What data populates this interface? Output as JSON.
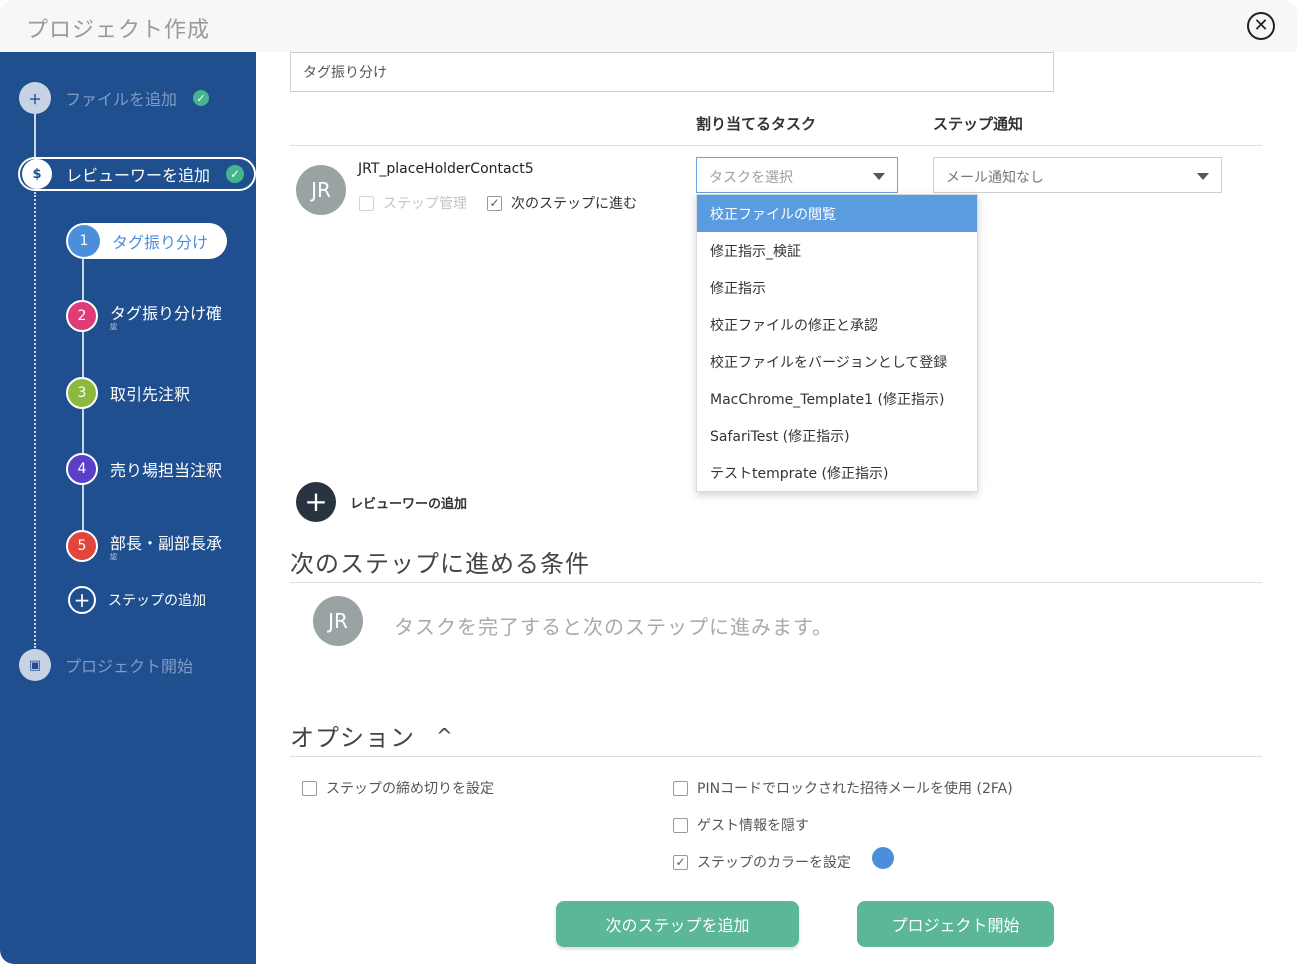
{
  "window": {
    "title": "プロジェクト作成"
  },
  "sidebar": {
    "steps": [
      {
        "label": "ファイルを追加"
      },
      {
        "label": "レビューワーを追加"
      },
      {
        "label": "プロジェクト開始"
      }
    ],
    "substeps": [
      {
        "num": "1",
        "label": "タグ振り分け"
      },
      {
        "num": "2",
        "label": "タグ振り分け確",
        "sub": "認"
      },
      {
        "num": "3",
        "label": "取引先注釈"
      },
      {
        "num": "4",
        "label": "売り場担当注釈"
      },
      {
        "num": "5",
        "label": "部長・副部長承",
        "sub": "認"
      }
    ],
    "add_step": "ステップの追加",
    "substep_colors": [
      "#4b8fdc",
      "#e03c78",
      "#8db83e",
      "#5a3fc8",
      "#e0463c"
    ]
  },
  "main": {
    "step_name": "タグ振り分け",
    "col_task": "割り当てるタスク",
    "col_notify": "ステップ通知",
    "reviewer": {
      "initials": "JR",
      "name": "JRT_placeHolderContact5",
      "step_manage": "ステップ管理",
      "advance": "次のステップに進む"
    },
    "task_select": {
      "placeholder": "タスクを選択"
    },
    "notify_select": {
      "value": "メール通知なし"
    },
    "task_options": [
      "校正ファイルの閲覧",
      "修正指示_検証",
      "修正指示",
      "校正ファイルの修正と承認",
      "校正ファイルをバージョンとして登録",
      "MacChrome_Template1 (修正指示)",
      "SafariTest (修正指示)",
      "テストtemprate (修正指示)"
    ],
    "add_reviewer": "レビューワーの追加",
    "condition_title": "次のステップに進める条件",
    "condition_initials": "JR",
    "condition_text": "タスクを完了すると次のステップに進みます。",
    "options_title": "オプション",
    "options": {
      "deadline": "ステップの締め切りを設定",
      "pin": "PINコードでロックされた招待メールを使用 (2FA)",
      "hide_guest": "ゲスト情報を隠す",
      "step_color": "ステップのカラーを設定"
    },
    "buttons": {
      "add_next": "次のステップを追加",
      "start": "プロジェクト開始"
    }
  }
}
